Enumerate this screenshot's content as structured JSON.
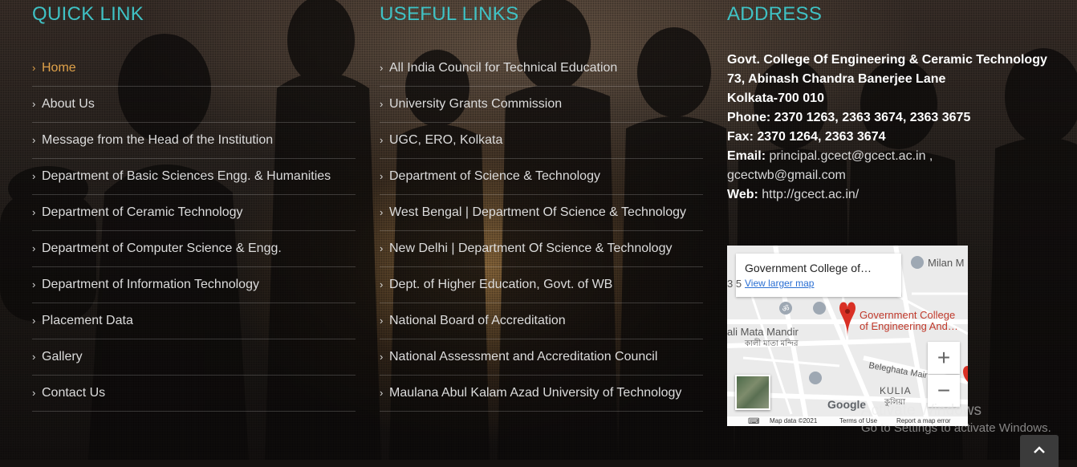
{
  "quick_link": {
    "heading": "QUICK LINK",
    "items": [
      {
        "label": "Home"
      },
      {
        "label": "About Us"
      },
      {
        "label": "Message from the Head of the Institution"
      },
      {
        "label": "Department of Basic Sciences Engg. & Humanities"
      },
      {
        "label": "Department of Ceramic Technology"
      },
      {
        "label": "Department of Computer Science & Engg."
      },
      {
        "label": "Department of Information Technology"
      },
      {
        "label": "Placement Data"
      },
      {
        "label": "Gallery"
      },
      {
        "label": "Contact Us"
      }
    ]
  },
  "useful_links": {
    "heading": "USEFUL LINKS",
    "items": [
      {
        "label": "All India Council for Technical Education"
      },
      {
        "label": "University Grants Commission"
      },
      {
        "label": "UGC, ERO, Kolkata"
      },
      {
        "label": "Department of Science & Technology"
      },
      {
        "label": "West Bengal | Department Of Science & Technology"
      },
      {
        "label": "New Delhi | Department Of Science & Technology"
      },
      {
        "label": "Dept. of Higher Education, Govt. of WB"
      },
      {
        "label": "National Board of Accreditation"
      },
      {
        "label": "National Assessment and Accreditation Council"
      },
      {
        "label": "Maulana Abul Kalam Azad University of Technology"
      }
    ]
  },
  "address": {
    "heading": "ADDRESS",
    "line1": "Govt. College Of Engineering & Ceramic Technology",
    "line2": "73, Abinash Chandra Banerjee Lane",
    "line3": "Kolkata-700 010",
    "phone": "Phone: 2370 1263, 2363 3674, 2363 3675",
    "fax": "Fax: 2370 1264, 2363 3674",
    "email_label": "Email:",
    "email1": "principal.gcect@gcect.ac.in ,",
    "email2": "gcectwb@gmail.com",
    "web_label": "Web:",
    "web": "http://gcect.ac.in/"
  },
  "map": {
    "place_title": "Government College of…",
    "larger_map": "View larger map",
    "pin_label_1": "Government College",
    "pin_label_2": "of Engineering And…",
    "milan": "Milan M",
    "mata_mandir": "ali Mata Mandir",
    "mata_mandir_bn": "কালী মাতা মন্দির",
    "beleghata": "Beleghata Mair",
    "kulia": "KULIA",
    "kulia_bn": "কুলিয়া",
    "digit": "3 5",
    "zoom_in": "+",
    "zoom_out": "−",
    "google": "Google",
    "map_data": "Map data ©2021",
    "terms": "Terms of Use",
    "report": "Report a map error"
  },
  "watermark": {
    "title": "Activate Windows",
    "subtitle": "Go to Settings to activate Windows."
  },
  "scroll_top_icon": "chevron-up-icon"
}
